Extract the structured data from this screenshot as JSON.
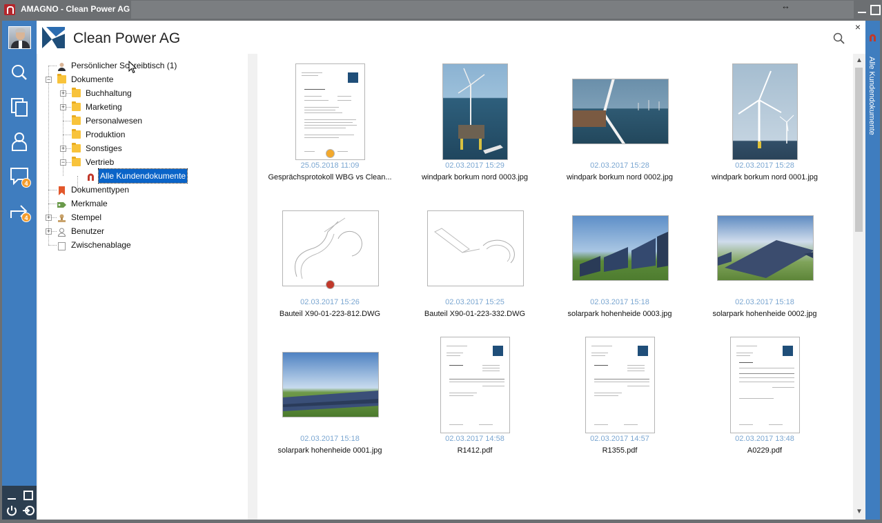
{
  "window": {
    "title": "AMAGNO - Clean Power AG",
    "minimize_icon": "minimize-icon",
    "maximize_icon": "maximize-icon",
    "resize_glyph": "↔"
  },
  "header": {
    "company_name": "Clean Power AG",
    "close_glyph": "×"
  },
  "nav": {
    "messages_badge": "4",
    "tasks_badge": "4"
  },
  "tree": {
    "items": [
      {
        "label": "Persönlicher Schreibtisch (1)"
      },
      {
        "label": "Dokumente"
      },
      {
        "label": "Buchhaltung"
      },
      {
        "label": "Marketing"
      },
      {
        "label": "Personalwesen"
      },
      {
        "label": "Produktion"
      },
      {
        "label": "Sonstiges"
      },
      {
        "label": "Vertrieb"
      },
      {
        "label": "Alle Kundendokumente"
      },
      {
        "label": "Dokumenttypen"
      },
      {
        "label": "Merkmale"
      },
      {
        "label": "Stempel"
      },
      {
        "label": "Benutzer"
      },
      {
        "label": "Zwischenablage"
      }
    ],
    "expanders": {
      "plus": "+",
      "minus": "−"
    }
  },
  "files": [
    {
      "date": "25.05.2018 11:09",
      "name": "Gesprächsprotokoll WBG vs Clean...",
      "kind": "doc"
    },
    {
      "date": "02.03.2017 15:29",
      "name": "windpark borkum nord 0003.jpg",
      "kind": "wind-portrait"
    },
    {
      "date": "02.03.2017 15:28",
      "name": "windpark borkum nord 0002.jpg",
      "kind": "wind-landscape"
    },
    {
      "date": "02.03.2017 15:28",
      "name": "windpark borkum nord 0001.jpg",
      "kind": "wind-portrait2"
    },
    {
      "date": "02.03.2017 15:26",
      "name": "Bauteil X90-01-223-812.DWG",
      "kind": "dwg"
    },
    {
      "date": "02.03.2017 15:25",
      "name": "Bauteil X90-01-223-332.DWG",
      "kind": "dwg"
    },
    {
      "date": "02.03.2017 15:18",
      "name": "solarpark hohenheide 0003.jpg",
      "kind": "solar"
    },
    {
      "date": "02.03.2017 15:18",
      "name": "solarpark hohenheide 0002.jpg",
      "kind": "solar"
    },
    {
      "date": "02.03.2017 15:18",
      "name": "solarpark hohenheide 0001.jpg",
      "kind": "solar-wide"
    },
    {
      "date": "02.03.2017 14:58",
      "name": "R1412.pdf",
      "kind": "doc"
    },
    {
      "date": "02.03.2017 14:57",
      "name": "R1355.pdf",
      "kind": "doc"
    },
    {
      "date": "02.03.2017 13:48",
      "name": "A0229.pdf",
      "kind": "doc"
    }
  ],
  "right_panel": {
    "label": "Alle Kundendokumente"
  },
  "colors": {
    "accent": "#3f7dbf",
    "selection": "#0a64c8",
    "date_text": "#7aa6d1",
    "badge": "#f39c2c"
  }
}
